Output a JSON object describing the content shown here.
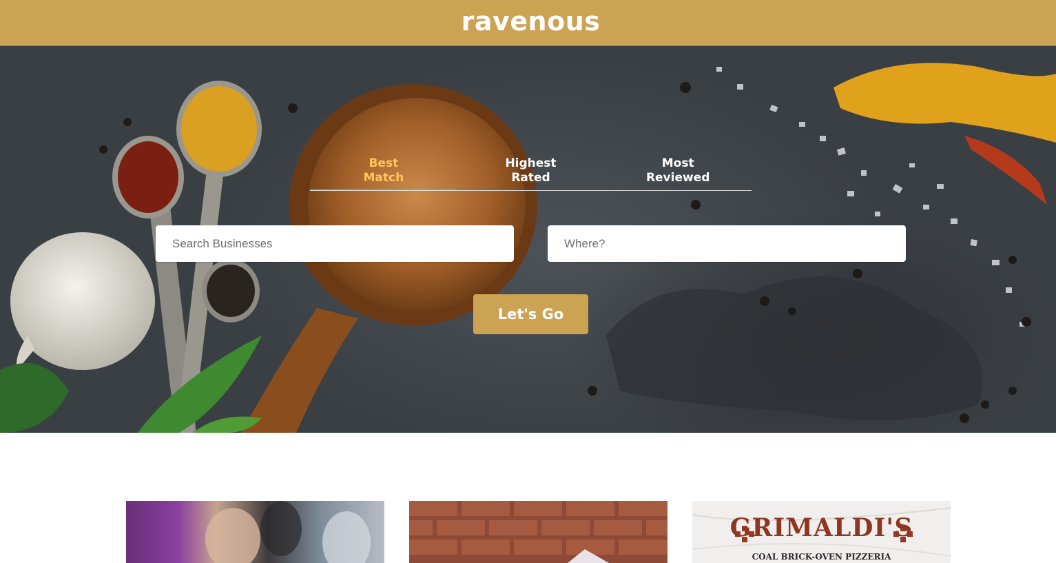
{
  "header": {
    "brand": "ravenous"
  },
  "colors": {
    "brand": "#cca353",
    "active_tab": "#ffc75a",
    "background": "#ffffff"
  },
  "search": {
    "sort_options": [
      {
        "label_line1": "Best",
        "label_line2": "Match",
        "active": true
      },
      {
        "label_line1": "Highest",
        "label_line2": "Rated",
        "active": false
      },
      {
        "label_line1": "Most",
        "label_line2": "Reviewed",
        "active": false
      }
    ],
    "term_placeholder": "Search Businesses",
    "location_placeholder": "Where?",
    "submit_label": "Let's Go"
  },
  "businesses": [
    {
      "image": "restaurant-diners-photo"
    },
    {
      "image": "brick-wall-photo"
    },
    {
      "image": "grimaldis-logo",
      "logo_name": "GRIMALDI'S",
      "logo_tagline": "COAL BRICK-OVEN PIZZERIA"
    }
  ]
}
